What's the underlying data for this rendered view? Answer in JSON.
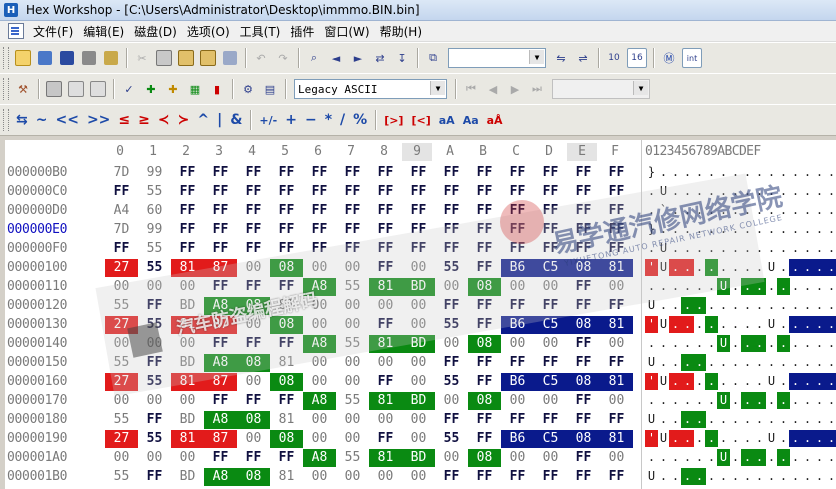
{
  "window": {
    "app_icon": "H",
    "title": "Hex Workshop - [C:\\Users\\Administrator\\Desktop\\immmo.BIN.bin]"
  },
  "menu": [
    "文件(F)",
    "编辑(E)",
    "磁盘(D)",
    "选项(O)",
    "工具(T)",
    "插件",
    "窗口(W)",
    "帮助(H)"
  ],
  "toolbar2": {
    "charset": "Legacy ASCII"
  },
  "toolbar3": {
    "buttons": [
      "⇆",
      "~",
      "<<",
      ">>",
      "≤",
      "≥",
      "≺",
      "≻",
      "^",
      "|",
      "&",
      "+/-",
      "+",
      "−",
      "*",
      "/",
      "%",
      "[>]",
      "[<]",
      "aA",
      "Aa",
      "aÅ"
    ]
  },
  "hex_header": {
    "cols": [
      "0",
      "1",
      "2",
      "3",
      "4",
      "5",
      "6",
      "7",
      "8",
      "9",
      "A",
      "B",
      "C",
      "D",
      "E",
      "F"
    ],
    "ascii": "0123456789ABCDEF"
  },
  "rows": [
    {
      "addr": "000000B0",
      "bytes": [
        "7D",
        "99",
        "FF",
        "FF",
        "FF",
        "FF",
        "FF",
        "FF",
        "FF",
        "FF",
        "FF",
        "FF",
        "FF",
        "FF",
        "FF",
        "FF"
      ],
      "ascii": "}."
    },
    {
      "addr": "000000C0",
      "bytes": [
        "FF",
        "55",
        "FF",
        "FF",
        "FF",
        "FF",
        "FF",
        "FF",
        "FF",
        "FF",
        "FF",
        "FF",
        "FF",
        "FF",
        "FF",
        "FF"
      ],
      "ascii": ".U"
    },
    {
      "addr": "000000D0",
      "bytes": [
        "A4",
        "60",
        "FF",
        "FF",
        "FF",
        "FF",
        "FF",
        "FF",
        "FF",
        "FF",
        "FF",
        "FF",
        "FF",
        "FF",
        "FF",
        "FF"
      ],
      "ascii": ".`"
    },
    {
      "addr": "000000E0",
      "bytes": [
        "7D",
        "99",
        "FF",
        "FF",
        "FF",
        "FF",
        "FF",
        "FF",
        "FF",
        "FF",
        "FF",
        "FF",
        "FF",
        "FF",
        "FF",
        "FF"
      ],
      "ascii": "}."
    },
    {
      "addr": "000000F0",
      "bytes": [
        "FF",
        "55",
        "FF",
        "FF",
        "FF",
        "FF",
        "FF",
        "FF",
        "FF",
        "FF",
        "FF",
        "FF",
        "FF",
        "FF",
        "FF",
        "FF"
      ],
      "ascii": ".U"
    },
    {
      "addr": "00000100",
      "bytes": [
        "27",
        "55",
        "81",
        "87",
        "00",
        "08",
        "00",
        "00",
        "FF",
        "00",
        "55",
        "FF",
        "B6",
        "C5",
        "08",
        "81"
      ],
      "ascii": "'U........U....."
    },
    {
      "addr": "00000110",
      "bytes": [
        "00",
        "00",
        "00",
        "FF",
        "FF",
        "FF",
        "A8",
        "55",
        "81",
        "BD",
        "00",
        "08",
        "00",
        "00",
        "FF",
        "00"
      ],
      "ascii": "......U........."
    },
    {
      "addr": "00000120",
      "bytes": [
        "55",
        "FF",
        "BD",
        "A8",
        "08",
        "81",
        "00",
        "00",
        "00",
        "00",
        "FF",
        "FF",
        "FF",
        "FF",
        "FF",
        "FF"
      ],
      "ascii": "U..............."
    },
    {
      "addr": "00000130",
      "bytes": [
        "27",
        "55",
        "81",
        "87",
        "00",
        "08",
        "00",
        "00",
        "FF",
        "00",
        "55",
        "FF",
        "B6",
        "C5",
        "08",
        "81"
      ],
      "ascii": "'U........U....."
    },
    {
      "addr": "00000140",
      "bytes": [
        "00",
        "00",
        "00",
        "FF",
        "FF",
        "FF",
        "A8",
        "55",
        "81",
        "BD",
        "00",
        "08",
        "00",
        "00",
        "FF",
        "00"
      ],
      "ascii": "......U........."
    },
    {
      "addr": "00000150",
      "bytes": [
        "55",
        "FF",
        "BD",
        "A8",
        "08",
        "81",
        "00",
        "00",
        "00",
        "00",
        "FF",
        "FF",
        "FF",
        "FF",
        "FF",
        "FF"
      ],
      "ascii": "U..............."
    },
    {
      "addr": "00000160",
      "bytes": [
        "27",
        "55",
        "81",
        "87",
        "00",
        "08",
        "00",
        "00",
        "FF",
        "00",
        "55",
        "FF",
        "B6",
        "C5",
        "08",
        "81"
      ],
      "ascii": "'U........U....."
    },
    {
      "addr": "00000170",
      "bytes": [
        "00",
        "00",
        "00",
        "FF",
        "FF",
        "FF",
        "A8",
        "55",
        "81",
        "BD",
        "00",
        "08",
        "00",
        "00",
        "FF",
        "00"
      ],
      "ascii": "......U........."
    },
    {
      "addr": "00000180",
      "bytes": [
        "55",
        "FF",
        "BD",
        "A8",
        "08",
        "81",
        "00",
        "00",
        "00",
        "00",
        "FF",
        "FF",
        "FF",
        "FF",
        "FF",
        "FF"
      ],
      "ascii": "U..............."
    },
    {
      "addr": "00000190",
      "bytes": [
        "27",
        "55",
        "81",
        "87",
        "00",
        "08",
        "00",
        "00",
        "FF",
        "00",
        "55",
        "FF",
        "B6",
        "C5",
        "08",
        "81"
      ],
      "ascii": "'U........U....."
    },
    {
      "addr": "000001A0",
      "bytes": [
        "00",
        "00",
        "00",
        "FF",
        "FF",
        "FF",
        "A8",
        "55",
        "81",
        "BD",
        "00",
        "08",
        "00",
        "00",
        "FF",
        "00"
      ],
      "ascii": "......U........."
    },
    {
      "addr": "000001B0",
      "bytes": [
        "55",
        "FF",
        "BD",
        "A8",
        "08",
        "81",
        "00",
        "00",
        "00",
        "00",
        "FF",
        "FF",
        "FF",
        "FF",
        "FF",
        "FF"
      ],
      "ascii": "U..............."
    }
  ],
  "highlight_colors": {
    "red": "#e21b1b",
    "green": "#0a8a12",
    "navy": "#0a1a8c"
  },
  "watermarks": {
    "school": "易学通汽修网络学院",
    "school_en": "YIXUETONG AUTO REPAIR NETWORK COLLEGE",
    "course": "汽车防盗编程解码"
  }
}
